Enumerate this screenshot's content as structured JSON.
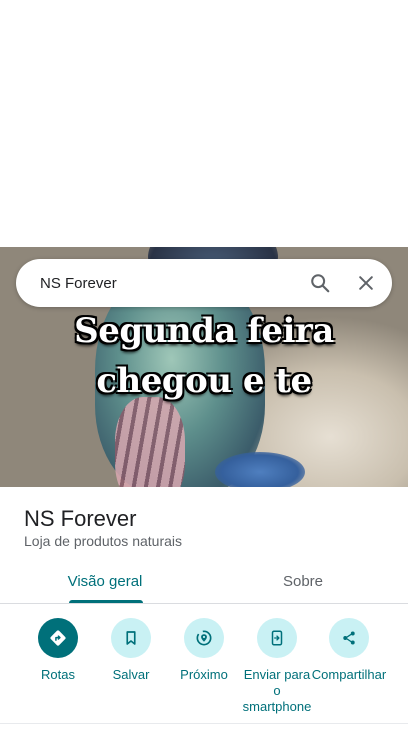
{
  "search": {
    "query": "NS Forever"
  },
  "photo": {
    "caption_line1": "Segunda feira",
    "caption_line2": "chegou e te"
  },
  "place": {
    "name": "NS Forever",
    "category": "Loja de produtos naturais"
  },
  "tabs": [
    {
      "label": "Visão geral",
      "selected": true
    },
    {
      "label": "Sobre",
      "selected": false
    }
  ],
  "actions": [
    {
      "label": "Rotas",
      "icon": "directions-icon"
    },
    {
      "label": "Salvar",
      "icon": "bookmark-icon"
    },
    {
      "label": "Próximo",
      "icon": "nearby-icon"
    },
    {
      "label": "Enviar para o smartphone",
      "icon": "send-to-phone-icon"
    },
    {
      "label": "Compartilhar",
      "icon": "share-icon"
    }
  ],
  "colors": {
    "accent": "#00707a",
    "action_bg": "#c9f1f4"
  }
}
